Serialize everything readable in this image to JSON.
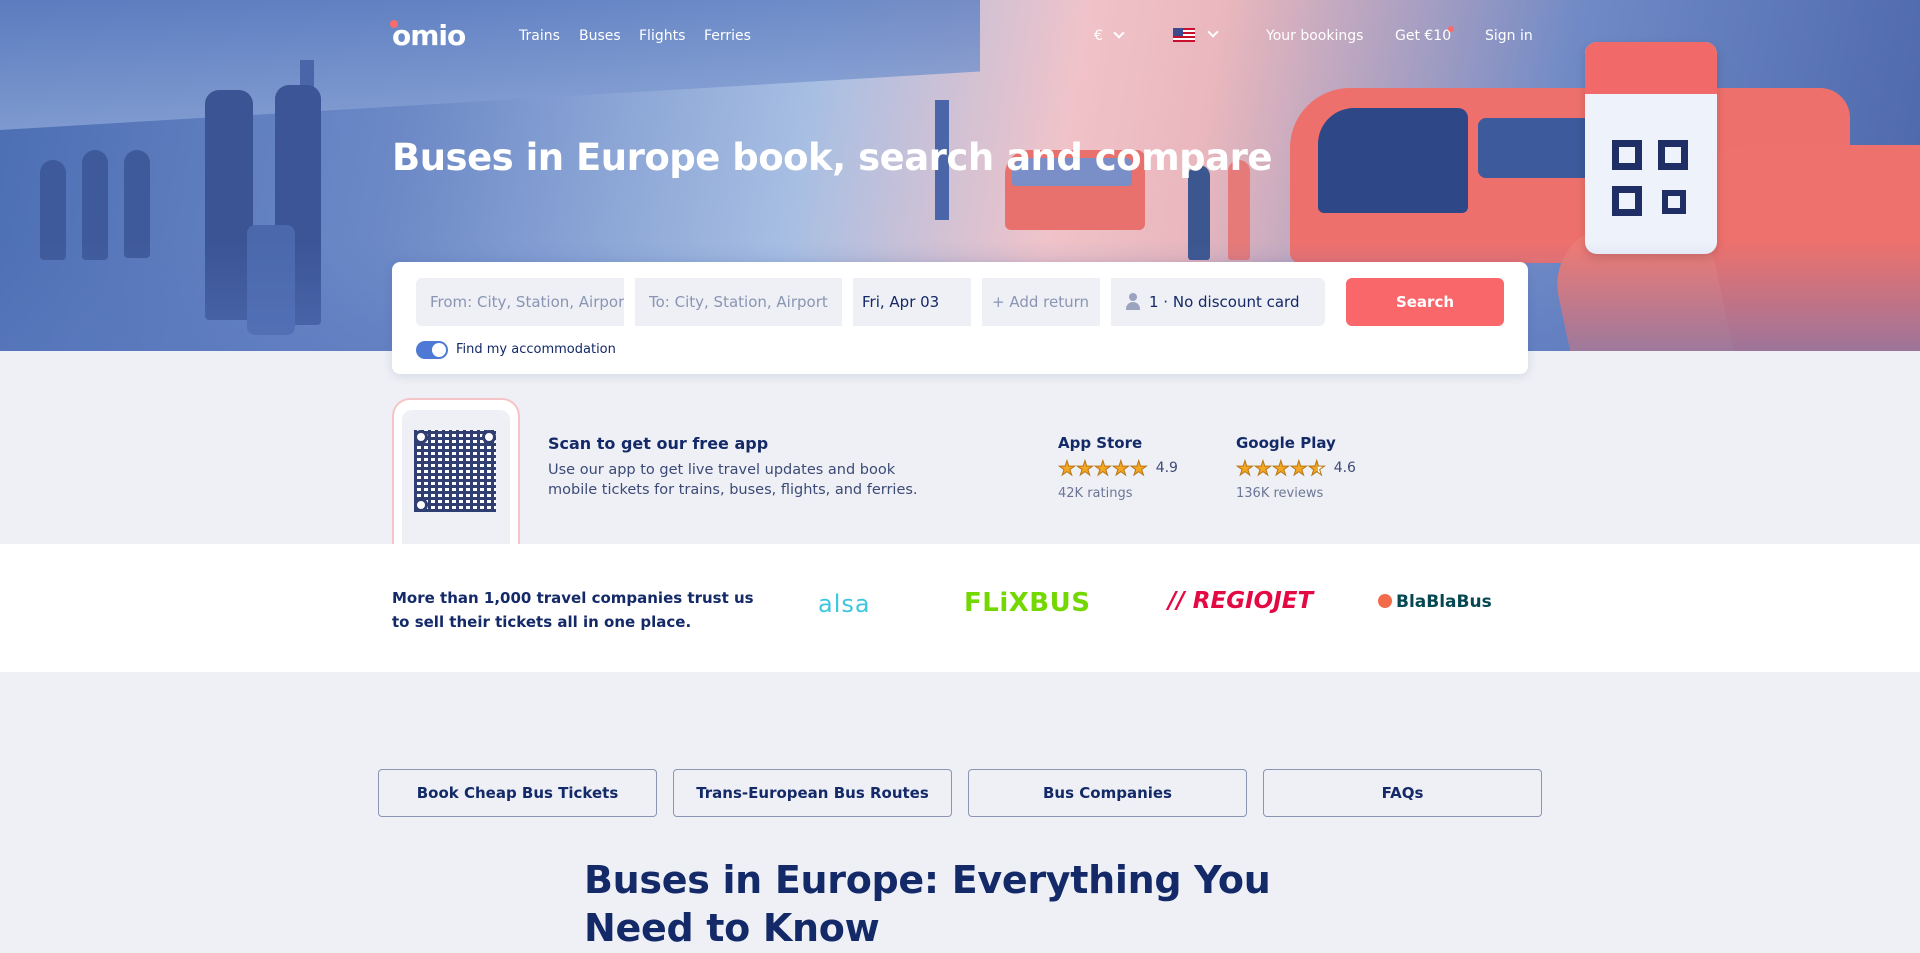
{
  "nav": {
    "logo": "omio",
    "links": [
      "Trains",
      "Buses",
      "Flights",
      "Ferries"
    ],
    "currency": "€",
    "bookings": "Your bookings",
    "promo": "Get €10",
    "signin": "Sign in"
  },
  "hero": {
    "title": "Buses in Europe book, search and compare"
  },
  "search": {
    "from_placeholder": "From: City, Station, Airport",
    "to_placeholder": "To: City, Station, Airport",
    "date": "Fri, Apr 03",
    "return": "+ Add return",
    "passengers": "1 · No discount card",
    "button": "Search",
    "accommodation_label": "Find my accommodation",
    "accommodation_on": true
  },
  "app": {
    "title": "Scan to get our free app",
    "description": "Use our app to get live travel updates and book mobile tickets for trains, buses, flights, and ferries.",
    "stores": [
      {
        "name": "App Store",
        "rating": "4.9",
        "stars": 5,
        "count": "42K ratings"
      },
      {
        "name": "Google Play",
        "rating": "4.6",
        "stars": 4.5,
        "count": "136K reviews"
      }
    ]
  },
  "partners": {
    "text": "More than 1,000 travel companies trust us to sell their tickets all in one place.",
    "logos": [
      {
        "name": "alsa",
        "color": "#3ec6e0"
      },
      {
        "name": "FLiXBUS",
        "color": "#73d700"
      },
      {
        "name": "// REGIOJET",
        "color": "#e30a43"
      },
      {
        "name": "BlaBlaBus",
        "color": "#054752"
      }
    ]
  },
  "tabs": [
    "Book Cheap Bus Tickets",
    "Trans-European Bus Routes",
    "Bus Companies",
    "FAQs"
  ],
  "section": {
    "title": "Buses in Europe: Everything You Need to Know"
  },
  "colors": {
    "brand": "#132968",
    "accent": "#f9676b",
    "toggle": "#4e7ad6"
  }
}
